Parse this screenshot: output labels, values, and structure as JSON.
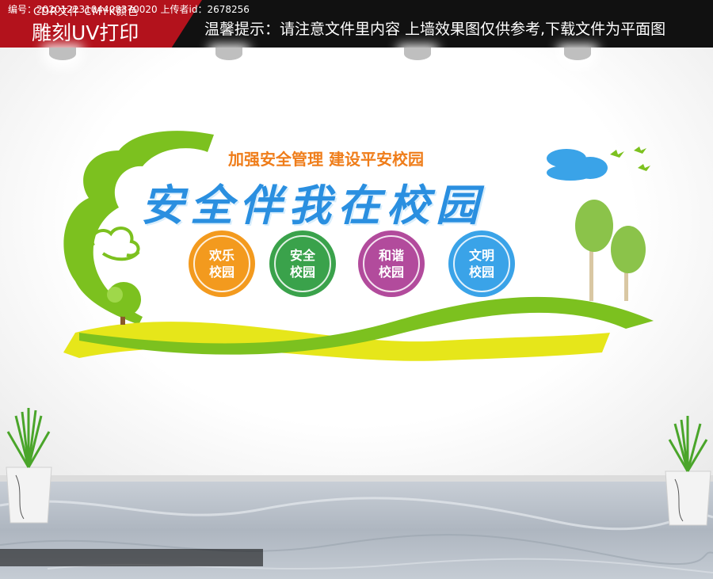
{
  "header": {
    "format_line": "CDR文件   CMYK颜色",
    "print_line": "雕刻UV打印",
    "notice": "温馨提示：请注意文件里内容 上墙效果图仅供参考,下载文件为平面图"
  },
  "board": {
    "slogan": "加强安全管理   建设平安校园",
    "title": "安全伴我在校园",
    "badges": [
      {
        "line1": "欢乐",
        "line2": "校园",
        "color": "#f39a1e"
      },
      {
        "line1": "安全",
        "line2": "校园",
        "color": "#3aa24b"
      },
      {
        "line1": "和谐",
        "line2": "校园",
        "color": "#b24b9c"
      },
      {
        "line1": "文明",
        "line2": "校园",
        "color": "#3aa3e8"
      }
    ]
  },
  "footer": {
    "info": "编号：20201223104408370020 上传者id：2678256"
  },
  "colors": {
    "red_band": "#b3121c",
    "title_blue": "#2a8fe0",
    "slogan_orange": "#ef7d1a",
    "ribbon_green": "#7cc11f",
    "ribbon_yellow": "#e6e61a"
  }
}
